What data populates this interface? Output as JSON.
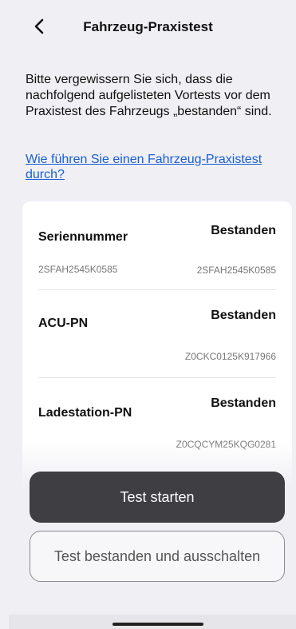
{
  "header": {
    "back_icon": "chevron-left-icon",
    "title": "Fahrzeug-Praxistest"
  },
  "intro_text": "Bitte vergewissern Sie sich, dass die nachfolgend aufgelisteten Vortests vor dem Praxistest des Fahrzeugs „bestanden“ sind.",
  "help_link": "Wie führen Sie einen Fahrzeug-Praxistest durch?",
  "tests": [
    {
      "name": "Seriennummer",
      "status": "Bestanden",
      "serial_left": "2SFAH2545K0585",
      "serial_right": "2SFAH2545K0585"
    },
    {
      "name": "ACU-PN",
      "status": "Bestanden",
      "serial_right": "Z0CKC0125K917966"
    },
    {
      "name": "Ladestation-PN",
      "status": "Bestanden",
      "serial_right": "Z0CQCYM25KQG0281"
    }
  ],
  "actions": {
    "start_label": "Test starten",
    "pass_off_label": "Test bestanden und ausschalten"
  },
  "colors": {
    "background": "#efeff4",
    "primary_button": "#3f3f43",
    "link": "#1a5fd1"
  }
}
